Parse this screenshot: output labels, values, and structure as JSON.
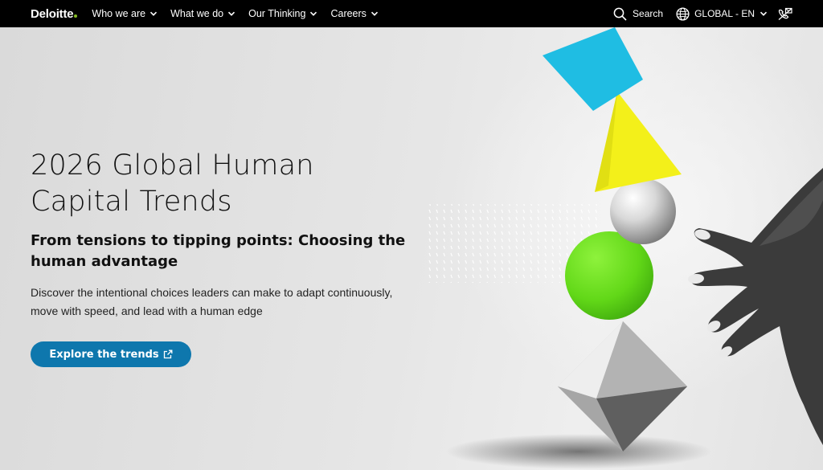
{
  "brand": {
    "name": "Deloitte",
    "dot_color": "#86bc25"
  },
  "nav": {
    "items": [
      {
        "label": "Who we are",
        "icon": "chevron-down-icon"
      },
      {
        "label": "What we do",
        "icon": "chevron-down-icon"
      },
      {
        "label": "Our Thinking",
        "icon": "chevron-down-icon"
      },
      {
        "label": "Careers",
        "icon": "chevron-down-icon"
      }
    ],
    "search_label": "Search",
    "language_label": "GLOBAL - EN"
  },
  "hero": {
    "title": "2026 Global Human Capital Trends",
    "subtitle": "From tensions to tipping points: Choosing the human advantage",
    "description": "Discover the intentional choices leaders can make to adapt continuously, move with speed, and lead with a human edge",
    "cta_label": "Explore the trends",
    "cta_color": "#0e77ad"
  },
  "illustration": {
    "square_color": "#1fbde3",
    "triangle_color": "#f3f01a",
    "sphere_color": "#6be01f"
  }
}
